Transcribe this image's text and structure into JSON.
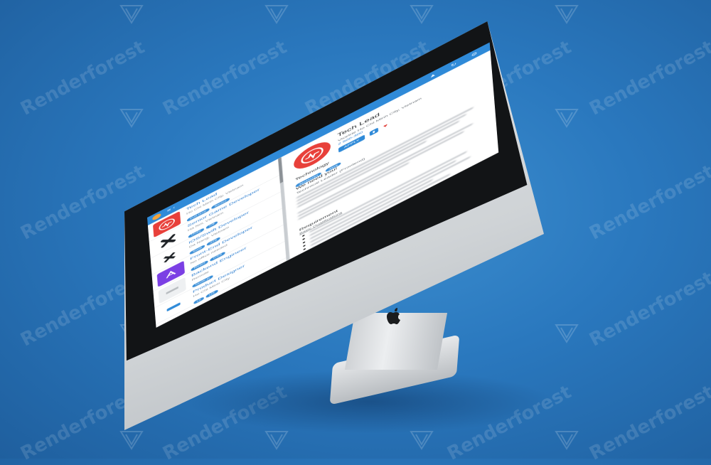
{
  "watermark": {
    "text": "Renderforest"
  },
  "app": {
    "titlebar": {
      "controls": "≡ ‹",
      "right_icons": "▲ ↻ ⚙"
    },
    "job_list": [
      {
        "title": "Tech Lead",
        "meta": "Ho Chi Minh City, Vietnam",
        "tags": [
          "Full-time",
          "Senior"
        ]
      },
      {
        "title": "Senior Game Developer",
        "meta": "Ha Noi, Vietnam",
        "tags": [
          "Unity",
          "C#"
        ]
      },
      {
        "title": "iOS/Swift Developer",
        "meta": "Da Nang, Vietnam",
        "tags": [
          "Swift",
          "iOS"
        ]
      },
      {
        "title": "Front-End Developer",
        "meta": "No office needed",
        "tags": [
          "React",
          "CSS"
        ]
      },
      {
        "title": "Backend Engineer",
        "meta": "Remote",
        "tags": [
          "Node.js"
        ]
      },
      {
        "title": "Product Designer",
        "meta": "Ho Chi Minh City",
        "tags": [
          "UI",
          "UX"
        ]
      }
    ],
    "detail": {
      "title": "Tech Lead",
      "location": "Vicetrie Ho Chi Minh City, Vietnam",
      "salary": "2 500-300",
      "apply_label": "APPLY",
      "tech_heading": "Technology",
      "tech_tags": [
        "Javascript",
        "Java"
      ],
      "need_you": "We need you!",
      "subtitle": "Technical Leader (Frontend)",
      "requirement_heading": "Requirement",
      "requirement_sub": "Basic Qualifications"
    }
  },
  "colors": {
    "accent": "#2f8ad8",
    "brand_red": "#e8403a",
    "background": "#2a78be"
  }
}
